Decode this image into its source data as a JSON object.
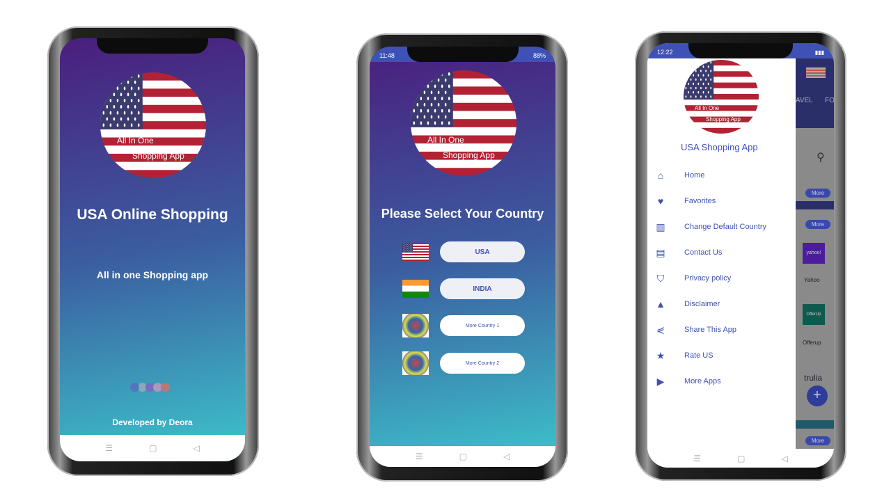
{
  "flag_logo": {
    "line1": "All In One",
    "line2": "Shopping App"
  },
  "splash": {
    "title": "USA Online Shopping",
    "subtitle": "All in one Shopping app",
    "footer": "Developed by Deora"
  },
  "select": {
    "status_time": "11:48",
    "battery": "88%",
    "title": "Please Select Your Country",
    "countries": [
      {
        "label": "USA",
        "flag": "usa-flag"
      },
      {
        "label": "INDIA",
        "flag": "india-flag"
      },
      {
        "label": "More Country 1",
        "flag": "globe-flag"
      },
      {
        "label": "More Country 2",
        "flag": "globe-flags"
      }
    ]
  },
  "drawer": {
    "status_time": "12:22",
    "app_name": "USA Shopping App",
    "items": [
      {
        "label": "Home",
        "icon": "home-icon",
        "g": "⌂"
      },
      {
        "label": "Favorites",
        "icon": "heart-icon",
        "g": "♥"
      },
      {
        "label": "Change Default Country",
        "icon": "map-icon",
        "g": "▥"
      },
      {
        "label": "Contact Us",
        "icon": "contact-card-icon",
        "g": "▤"
      },
      {
        "label": "Privacy policy",
        "icon": "shield-icon",
        "g": "⛉"
      },
      {
        "label": "Disclaimer",
        "icon": "warning-icon",
        "g": "▲"
      },
      {
        "label": "Share This App",
        "icon": "share-icon",
        "g": "⋞"
      },
      {
        "label": "Rate US",
        "icon": "star-icon",
        "g": "★"
      },
      {
        "label": "More Apps",
        "icon": "play-icon",
        "g": "▶"
      }
    ],
    "background": {
      "tab_partial_1": "AVEL",
      "tab_partial_2": "FO",
      "more": "More",
      "yahoo": "Yahoo",
      "yahoo_logo": "yahoo!",
      "offerup": "Offerup",
      "offerup_logo": "OfferUp",
      "trulia": "trulia"
    }
  },
  "colors": {
    "accent": "#3f51b5",
    "flag_red": "#b22234",
    "flag_blue": "#3c3b6e"
  }
}
